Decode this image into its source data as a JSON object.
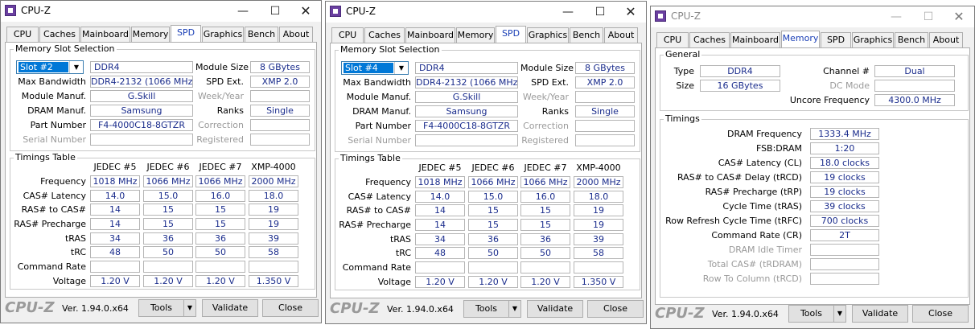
{
  "app_title": "CPU-Z",
  "tabs": [
    "CPU",
    "Caches",
    "Mainboard",
    "Memory",
    "SPD",
    "Graphics",
    "Bench",
    "About"
  ],
  "spd_labels": {
    "group": "Memory Slot Selection",
    "max_bandwidth": "Max Bandwidth",
    "module_manuf": "Module Manuf.",
    "dram_manuf": "DRAM Manuf.",
    "part_number": "Part Number",
    "serial_number": "Serial Number",
    "module_size": "Module Size",
    "spd_ext": "SPD Ext.",
    "week_year": "Week/Year",
    "ranks": "Ranks",
    "correction": "Correction",
    "registered": "Registered",
    "timings_group": "Timings Table",
    "rows": [
      "Frequency",
      "CAS# Latency",
      "RAS# to CAS#",
      "RAS# Precharge",
      "tRAS",
      "tRC",
      "Command Rate",
      "Voltage"
    ]
  },
  "windows": [
    {
      "slot": "Slot #2",
      "type": "DDR4",
      "module_size": "8 GBytes",
      "max_bandwidth": "DDR4-2132 (1066 MHz)",
      "spd_ext": "XMP 2.0",
      "module_manuf": "G.Skill",
      "dram_manuf": "Samsung",
      "ranks": "Single",
      "part_number": "F4-4000C18-8GTZR",
      "columns": [
        "JEDEC #5",
        "JEDEC #6",
        "JEDEC #7",
        "XMP-4000"
      ],
      "timings": [
        [
          "1018 MHz",
          "1066 MHz",
          "1066 MHz",
          "2000 MHz"
        ],
        [
          "14.0",
          "15.0",
          "16.0",
          "18.0"
        ],
        [
          "14",
          "15",
          "15",
          "19"
        ],
        [
          "14",
          "15",
          "15",
          "19"
        ],
        [
          "34",
          "36",
          "36",
          "39"
        ],
        [
          "48",
          "50",
          "50",
          "58"
        ],
        [
          "",
          "",
          "",
          ""
        ],
        [
          "1.20 V",
          "1.20 V",
          "1.20 V",
          "1.350 V"
        ]
      ]
    },
    {
      "slot": "Slot #4",
      "type": "DDR4",
      "module_size": "8 GBytes",
      "max_bandwidth": "DDR4-2132 (1066 MHz)",
      "spd_ext": "XMP 2.0",
      "module_manuf": "G.Skill",
      "dram_manuf": "Samsung",
      "ranks": "Single",
      "part_number": "F4-4000C18-8GTZR",
      "columns": [
        "JEDEC #5",
        "JEDEC #6",
        "JEDEC #7",
        "XMP-4000"
      ],
      "timings": [
        [
          "1018 MHz",
          "1066 MHz",
          "1066 MHz",
          "2000 MHz"
        ],
        [
          "14.0",
          "15.0",
          "16.0",
          "18.0"
        ],
        [
          "14",
          "15",
          "15",
          "19"
        ],
        [
          "14",
          "15",
          "15",
          "19"
        ],
        [
          "34",
          "36",
          "36",
          "39"
        ],
        [
          "48",
          "50",
          "50",
          "58"
        ],
        [
          "",
          "",
          "",
          ""
        ],
        [
          "1.20 V",
          "1.20 V",
          "1.20 V",
          "1.350 V"
        ]
      ]
    }
  ],
  "memory": {
    "general_label": "General",
    "type_label": "Type",
    "type": "DDR4",
    "size_label": "Size",
    "size": "16 GBytes",
    "channel_label": "Channel #",
    "channel": "Dual",
    "dc_mode_label": "DC Mode",
    "uncore_label": "Uncore Frequency",
    "uncore": "4300.0 MHz",
    "timings_label": "Timings",
    "rows": [
      {
        "label": "DRAM Frequency",
        "value": "1333.4 MHz",
        "disabled": false
      },
      {
        "label": "FSB:DRAM",
        "value": "1:20",
        "disabled": false
      },
      {
        "label": "CAS# Latency (CL)",
        "value": "18.0 clocks",
        "disabled": false
      },
      {
        "label": "RAS# to CAS# Delay (tRCD)",
        "value": "19 clocks",
        "disabled": false
      },
      {
        "label": "RAS# Precharge (tRP)",
        "value": "19 clocks",
        "disabled": false
      },
      {
        "label": "Cycle Time (tRAS)",
        "value": "39 clocks",
        "disabled": false
      },
      {
        "label": "Row Refresh Cycle Time (tRFC)",
        "value": "700 clocks",
        "disabled": false
      },
      {
        "label": "Command Rate (CR)",
        "value": "2T",
        "disabled": false
      },
      {
        "label": "DRAM Idle Timer",
        "value": "",
        "disabled": true
      },
      {
        "label": "Total CAS# (tRDRAM)",
        "value": "",
        "disabled": true
      },
      {
        "label": "Row To Column (tRCD)",
        "value": "",
        "disabled": true
      }
    ]
  },
  "footer": {
    "brand": "CPU-Z",
    "version": "Ver. 1.94.0.x64",
    "tools": "Tools",
    "validate": "Validate",
    "close": "Close"
  },
  "window_controls": {
    "minimize": "—",
    "maximize": "☐",
    "close": "✕"
  },
  "dropdown_arrow": "▼"
}
